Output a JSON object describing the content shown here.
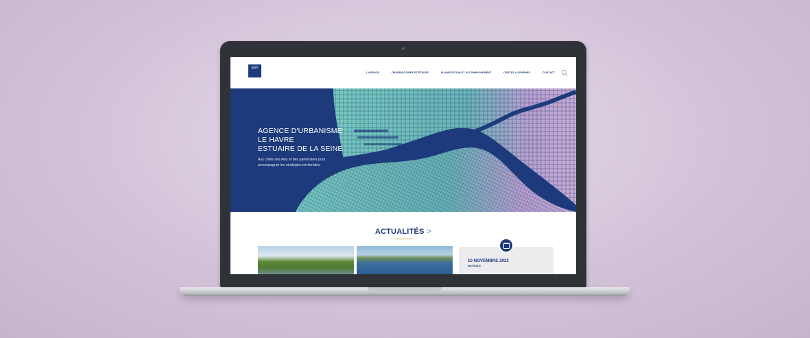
{
  "header": {
    "logo_text": "aurh",
    "nav": [
      {
        "label": "L'AGENCE"
      },
      {
        "label": "OBSERVATOIRES ET ÉTUDES"
      },
      {
        "label": "PLANIFICATION ET ACCOMPAGNEMENT"
      },
      {
        "label": "CARTES & GRAPHES"
      },
      {
        "label": "CONTACT"
      }
    ],
    "search_icon": "search-icon"
  },
  "hero": {
    "title_line1": "AGENCE D'URBANISME",
    "title_line2": "LE HAVRE",
    "title_line3": "ESTUAIRE DE LA SEINE",
    "subtitle": "Aux côtés des élus et des partenaires pour accompagner les stratégies territoriales"
  },
  "news": {
    "heading": "ACTUALITÉS",
    "arrow": ">",
    "card3_date": "10 NOVEMBRE 2023",
    "card3_tag": "MATINALE",
    "card3_icon": "calendar-icon"
  },
  "colors": {
    "brand_blue": "#1c3a7a",
    "background": "#d3c3d9",
    "accent_gold": "#c9a640"
  }
}
